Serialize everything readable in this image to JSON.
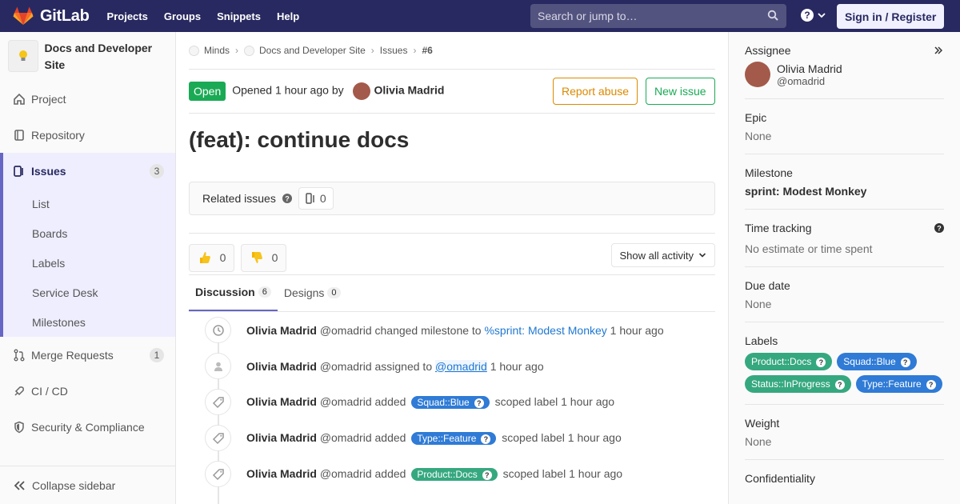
{
  "topbar": {
    "brand": "GitLab",
    "nav": [
      "Projects",
      "Groups",
      "Snippets",
      "Help"
    ],
    "search_placeholder": "Search or jump to…",
    "signin": "Sign in / Register"
  },
  "sidebar": {
    "project_name": "Docs and Developer Site",
    "items": [
      {
        "label": "Project"
      },
      {
        "label": "Repository"
      },
      {
        "label": "Issues",
        "count": "3"
      },
      {
        "label": "Merge Requests",
        "count": "1"
      },
      {
        "label": "CI / CD"
      },
      {
        "label": "Security & Compliance"
      }
    ],
    "issue_sub": [
      "List",
      "Boards",
      "Labels",
      "Service Desk",
      "Milestones"
    ],
    "collapse": "Collapse sidebar"
  },
  "breadcrumb": [
    "Minds",
    "Docs and Developer Site",
    "Issues",
    "#6"
  ],
  "issue": {
    "status": "Open",
    "opened_text": "Opened",
    "opened_time": "1 hour ago",
    "by": "by",
    "author": "Olivia Madrid",
    "report_abuse": "Report abuse",
    "new_issue": "New issue",
    "title": "(feat): continue docs",
    "related_label": "Related issues",
    "related_count": "0",
    "thumbs_up": "0",
    "thumbs_down": "0",
    "activity_filter": "Show all activity"
  },
  "tabs": [
    {
      "label": "Discussion",
      "count": "6"
    },
    {
      "label": "Designs",
      "count": "0"
    }
  ],
  "notes": [
    {
      "author": "Olivia Madrid",
      "handle": "@omadrid",
      "action": "changed milestone to",
      "target": "%sprint: Modest Monkey",
      "time": "1 hour ago",
      "icon": "clock-icon"
    },
    {
      "author": "Olivia Madrid",
      "handle": "@omadrid",
      "action": "assigned to",
      "target": "@omadrid",
      "time": "1 hour ago",
      "icon": "user-icon"
    },
    {
      "author": "Olivia Madrid",
      "handle": "@omadrid",
      "action": "added",
      "label": "Squad::Blue",
      "after": "scoped label",
      "time": "1 hour ago",
      "icon": "tag-icon"
    },
    {
      "author": "Olivia Madrid",
      "handle": "@omadrid",
      "action": "added",
      "label": "Type::Feature",
      "after": "scoped label",
      "time": "1 hour ago",
      "icon": "tag-icon"
    },
    {
      "author": "Olivia Madrid",
      "handle": "@omadrid",
      "action": "added",
      "label": "Product::Docs",
      "after": "scoped label",
      "time": "1 hour ago",
      "icon": "tag-icon"
    }
  ],
  "right_sidebar": {
    "assignee_title": "Assignee",
    "assignee_name": "Olivia Madrid",
    "assignee_handle": "@omadrid",
    "epic_title": "Epic",
    "epic_value": "None",
    "milestone_title": "Milestone",
    "milestone_value": "sprint: Modest Monkey",
    "time_title": "Time tracking",
    "time_value": "No estimate or time spent",
    "due_title": "Due date",
    "due_value": "None",
    "labels_title": "Labels",
    "labels": [
      "Product::Docs",
      "Squad::Blue",
      "Status::InProgress",
      "Type::Feature"
    ],
    "weight_title": "Weight",
    "weight_value": "None",
    "confidentiality_title": "Confidentiality"
  },
  "colors": {
    "topbar": "#292961",
    "open": "#1aaa55",
    "label_green": "#36a880",
    "label_blue": "#2f7bd6",
    "report_abuse": "#db8a00",
    "new_issue": "#1aaa55"
  }
}
